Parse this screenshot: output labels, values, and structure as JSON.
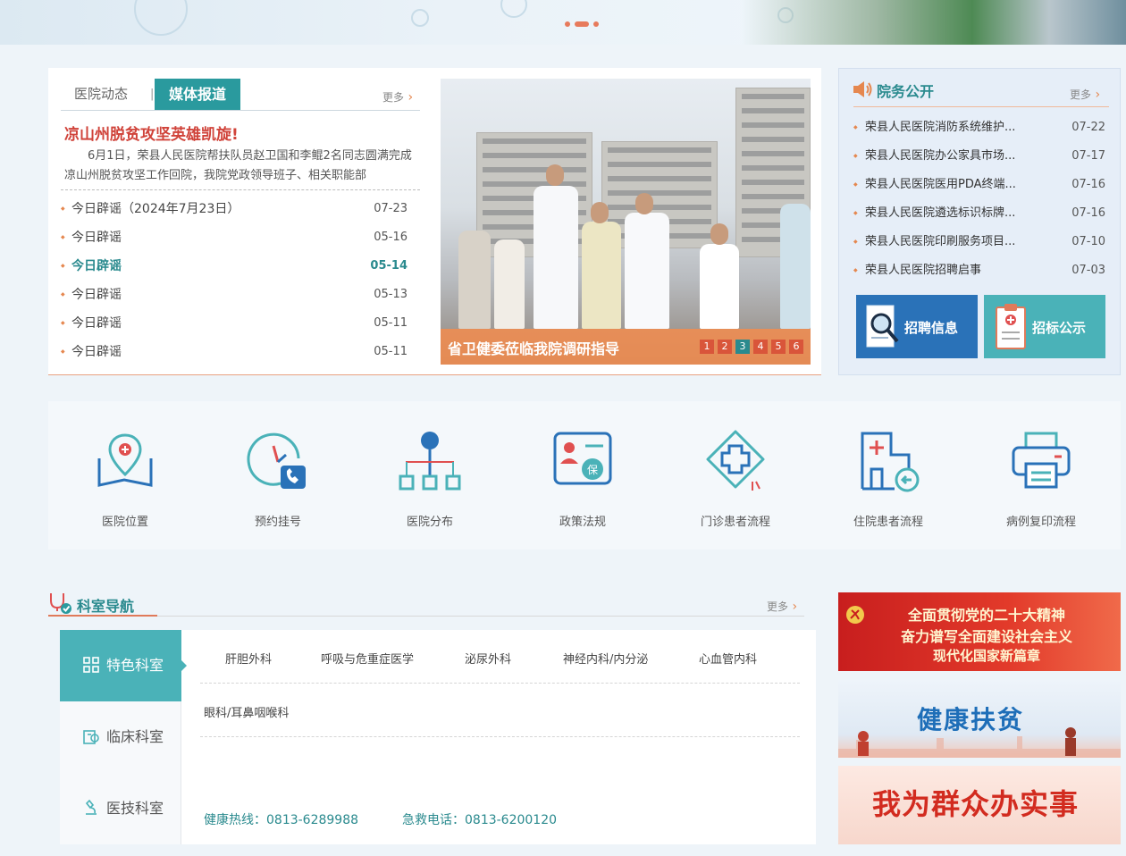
{
  "news": {
    "tabs": [
      "医院动态",
      "|",
      "媒体报道"
    ],
    "more": "更多",
    "headline": "凉山州脱贫攻坚英雄凯旋!",
    "summary": "6月1日，荣县人民医院帮扶队员赵卫国和李鲲2名同志圆满完成凉山州脱贫攻坚工作回院，我院党政领导班子、相关职能部",
    "items": [
      {
        "title": "今日辟谣（2024年7月23日）",
        "date": "07-23"
      },
      {
        "title": "今日辟谣",
        "date": "05-16"
      },
      {
        "title": "今日辟谣",
        "date": "05-14"
      },
      {
        "title": "今日辟谣",
        "date": "05-13"
      },
      {
        "title": "今日辟谣",
        "date": "05-11"
      },
      {
        "title": "今日辟谣",
        "date": "05-11"
      }
    ]
  },
  "slider": {
    "caption": "省卫健委莅临我院调研指导",
    "pages": [
      "1",
      "2",
      "3",
      "4",
      "5",
      "6"
    ],
    "active_page": "3"
  },
  "affairs": {
    "title": "院务公开",
    "more": "更多",
    "items": [
      {
        "title": "荣县人民医院消防系统维护...",
        "date": "07-22"
      },
      {
        "title": "荣县人民医院办公家具市场...",
        "date": "07-17"
      },
      {
        "title": "荣县人民医院医用PDA终端...",
        "date": "07-16"
      },
      {
        "title": "荣县人民医院遴选标识标牌...",
        "date": "07-16"
      },
      {
        "title": "荣县人民医院印刷服务项目...",
        "date": "07-10"
      },
      {
        "title": "荣县人民医院招聘启事",
        "date": "07-03"
      }
    ],
    "btn_recruit": "招聘信息",
    "btn_tender": "招标公示"
  },
  "services": [
    {
      "label": "医院位置",
      "icon": "map-pin-icon"
    },
    {
      "label": "预约挂号",
      "icon": "clock-phone-icon"
    },
    {
      "label": "医院分布",
      "icon": "org-tree-icon"
    },
    {
      "label": "政策法规",
      "icon": "insurance-card-icon"
    },
    {
      "label": "门诊患者流程",
      "icon": "medical-cross-icon"
    },
    {
      "label": "住院患者流程",
      "icon": "hospital-building-icon"
    },
    {
      "label": "病例复印流程",
      "icon": "printer-icon"
    }
  ],
  "departments": {
    "title": "科室导航",
    "more": "更多",
    "tabs": [
      "特色科室",
      "临床科室",
      "医技科室"
    ],
    "active_tab": "特色科室",
    "row1": [
      "肝胆外科",
      "呼吸与危重症医学",
      "泌尿外科",
      "神经内科/内分泌",
      "心血管内科"
    ],
    "row2": [
      "眼科/耳鼻咽喉科"
    ],
    "hotline": "健康热线：0813-6289988",
    "emergency": "急救电话：0813-6200120"
  },
  "banners": {
    "party_line1": "全面贯彻党的二十大精神",
    "party_line2": "奋力谱写全面建设社会主义",
    "party_line3": "现代化国家新篇章",
    "health_poverty": "健康扶贫",
    "serve_people": "我为群众办实事"
  },
  "colors": {
    "accent_teal": "#2a9a9e",
    "accent_orange": "#e5874f",
    "headline_red": "#d0433a",
    "icon_blue": "#2a72b8"
  }
}
